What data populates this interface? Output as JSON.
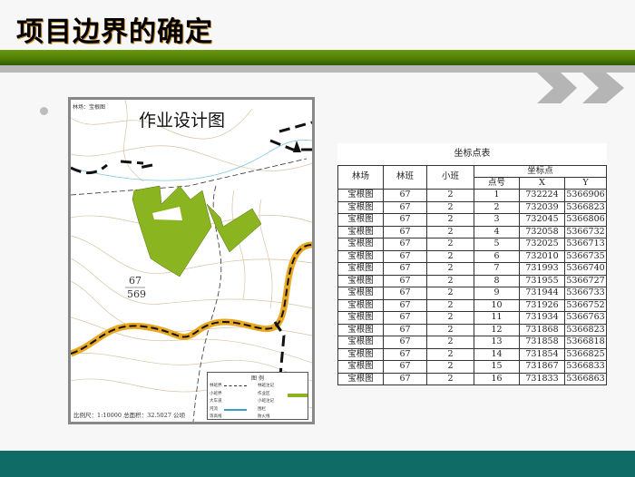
{
  "slide": {
    "title": "项目边界的确定",
    "accent": "#4e7d05",
    "footer_color": "#0e6b66"
  },
  "map": {
    "title": "作业设计图",
    "forest_farm": "林场：宝根图",
    "label_top": "67",
    "label_bottom": "569",
    "scale_text": "比例尺：1:10000  总面积：32.5027 公顷",
    "north": "N",
    "legend": {
      "title": "图   例",
      "left": [
        "林班界",
        "小班界",
        "大车道",
        "河流",
        "等高线"
      ],
      "right": [
        "林班注记",
        "作业区",
        "小班注记",
        "围栏",
        "防火线"
      ]
    }
  },
  "table": {
    "caption": "坐标点表",
    "headers": {
      "farm": "林场",
      "compartment": "林班",
      "subcompartment": "小班",
      "coord_group": "坐标点",
      "point": "点号",
      "x": "X",
      "y": "Y"
    },
    "rows": [
      [
        "宝根图",
        "67",
        "2",
        "1",
        "732224",
        "5366906"
      ],
      [
        "宝根图",
        "67",
        "2",
        "2",
        "732039",
        "5366823"
      ],
      [
        "宝根图",
        "67",
        "2",
        "3",
        "732045",
        "5366806"
      ],
      [
        "宝根图",
        "67",
        "2",
        "4",
        "732058",
        "5366732"
      ],
      [
        "宝根图",
        "67",
        "2",
        "5",
        "732025",
        "5366713"
      ],
      [
        "宝根图",
        "67",
        "2",
        "6",
        "732010",
        "5366735"
      ],
      [
        "宝根图",
        "67",
        "2",
        "7",
        "731993",
        "5366740"
      ],
      [
        "宝根图",
        "67",
        "2",
        "8",
        "731955",
        "5366727"
      ],
      [
        "宝根图",
        "67",
        "2",
        "9",
        "731944",
        "5366733"
      ],
      [
        "宝根图",
        "67",
        "2",
        "10",
        "731926",
        "5366752"
      ],
      [
        "宝根图",
        "67",
        "2",
        "11",
        "731934",
        "5366763"
      ],
      [
        "宝根图",
        "67",
        "2",
        "12",
        "731868",
        "5366823"
      ],
      [
        "宝根图",
        "67",
        "2",
        "13",
        "731858",
        "5366818"
      ],
      [
        "宝根图",
        "67",
        "2",
        "14",
        "731854",
        "5366825"
      ],
      [
        "宝根图",
        "67",
        "2",
        "15",
        "731867",
        "5366833"
      ],
      [
        "宝根图",
        "67",
        "2",
        "16",
        "731833",
        "5366863"
      ]
    ]
  }
}
